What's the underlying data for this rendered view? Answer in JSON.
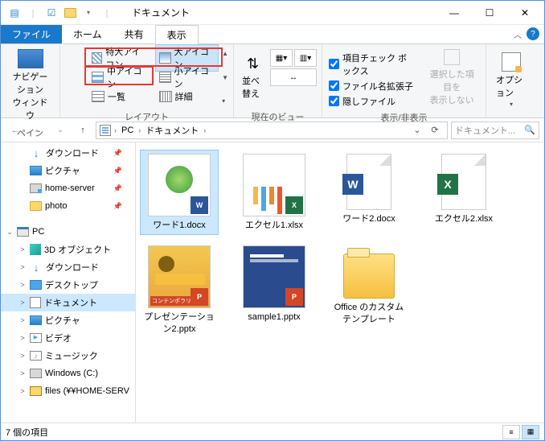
{
  "title": "ドキュメント",
  "tabs": {
    "file": "ファイル",
    "home": "ホーム",
    "share": "共有",
    "view": "表示"
  },
  "ribbon": {
    "pane": {
      "nav_label": "ナビゲーション\nウィンドウ",
      "group": "ペイン"
    },
    "layout": {
      "xl": "特大アイコン",
      "lg": "大アイコン",
      "md": "中アイコン",
      "sm": "小アイコン",
      "ls": "一覧",
      "dt": "詳細",
      "group": "レイアウト"
    },
    "sort": {
      "label": "並べ替え",
      "group": "現在のビュー"
    },
    "show": {
      "chk_boxes": "項目チェック ボックス",
      "ext": "ファイル名拡張子",
      "hidden": "隠しファイル",
      "sel_hide": "選択した項目を\n表示しない",
      "group": "表示/非表示"
    },
    "options": "オプション"
  },
  "address": {
    "pc": "PC",
    "folder": "ドキュメント"
  },
  "search_placeholder": "ドキュメント...",
  "tree": [
    {
      "icon": "dl",
      "label": "ダウンロード",
      "pin": true,
      "indent": 1
    },
    {
      "icon": "pict",
      "label": "ピクチャ",
      "pin": true,
      "indent": 1
    },
    {
      "icon": "srv",
      "label": "home-server",
      "pin": true,
      "indent": 1
    },
    {
      "icon": "folder",
      "label": "photo",
      "pin": true,
      "indent": 1
    },
    {
      "spacer": true
    },
    {
      "icon": "pc",
      "label": "PC",
      "chv": "⌄",
      "indent": 0
    },
    {
      "icon": "obj3d",
      "label": "3D オブジェクト",
      "indent": 1,
      "chv": ">"
    },
    {
      "icon": "dl",
      "label": "ダウンロード",
      "indent": 1,
      "chv": ">"
    },
    {
      "icon": "desk",
      "label": "デスクトップ",
      "indent": 1,
      "chv": ">"
    },
    {
      "icon": "doc",
      "label": "ドキュメント",
      "indent": 1,
      "chv": ">",
      "sel": true
    },
    {
      "icon": "pict",
      "label": "ピクチャ",
      "indent": 1,
      "chv": ">"
    },
    {
      "icon": "vid",
      "label": "ビデオ",
      "indent": 1,
      "chv": ">"
    },
    {
      "icon": "mus",
      "label": "ミュージック",
      "indent": 1,
      "chv": ">"
    },
    {
      "icon": "disk",
      "label": "Windows (C:)",
      "indent": 1,
      "chv": ">"
    },
    {
      "icon": "net",
      "label": "files (¥¥HOME-SERV",
      "indent": 1,
      "chv": ">"
    }
  ],
  "files": [
    {
      "name": "ワード1.docx",
      "thumb": "doc1",
      "badge": "word",
      "sel": true
    },
    {
      "name": "エクセル1.xlsx",
      "thumb": "xl1",
      "badge": "excel"
    },
    {
      "name": "ワード2.docx",
      "bigicon": "word"
    },
    {
      "name": "エクセル2.xlsx",
      "bigicon": "excel"
    },
    {
      "name": "プレゼンテーション2.pptx",
      "thumb": "pp1",
      "badge": "ppt",
      "strip": "コンテンポラリ フォト アル"
    },
    {
      "name": "sample1.pptx",
      "thumb": "pp2",
      "badge": "ppt"
    },
    {
      "name": "Office のカスタム テンプレート",
      "folder": true
    }
  ],
  "status": "7 個の項目"
}
